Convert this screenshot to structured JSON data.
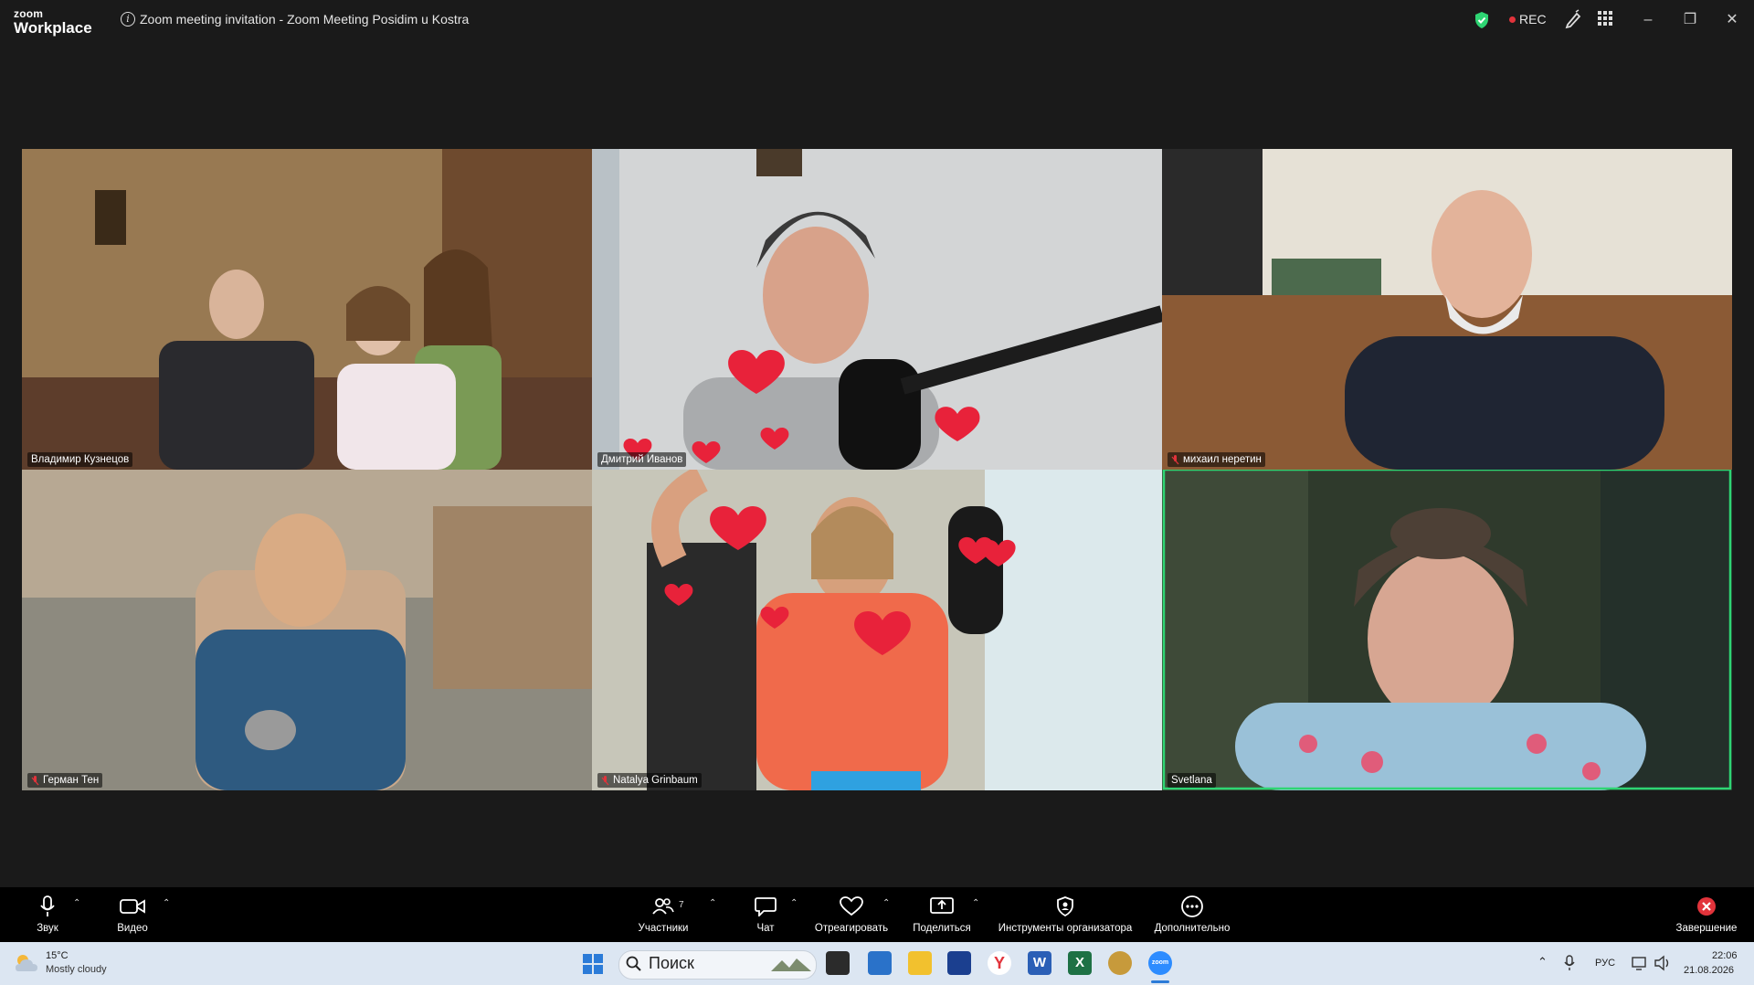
{
  "app": {
    "logo_small": "zoom",
    "logo_big": "Workplace",
    "window_title": "Zoom meeting invitation - Zoom Meeting Posidim u Kostra",
    "rec_label": "REC",
    "brand_color": "#2d8cff",
    "active_speaker_color": "#2ed573",
    "rec_color": "#e2333b"
  },
  "participants": [
    {
      "name": "Владимир Кузнецов",
      "muted": false,
      "active": false
    },
    {
      "name": "Дмитрий Иванов",
      "muted": false,
      "active": false
    },
    {
      "name": "михаил неретин",
      "muted": true,
      "active": false
    },
    {
      "name": "Герман Тен",
      "muted": true,
      "active": false
    },
    {
      "name": "Natalya Grinbaum",
      "muted": true,
      "active": false
    },
    {
      "name": "Svetlana",
      "muted": false,
      "active": true
    }
  ],
  "toolbar": {
    "audio_label": "Звук",
    "video_label": "Видео",
    "participants_label": "Участники",
    "participants_count": "7",
    "chat_label": "Чат",
    "react_label": "Отреагировать",
    "share_label": "Поделиться",
    "host_tools_label": "Инструменты организатора",
    "more_label": "Дополнительно",
    "end_label": "Завершение"
  },
  "taskbar": {
    "weather_temp": "15°C",
    "weather_desc": "Mostly cloudy",
    "search_placeholder": "Поиск",
    "lang": "РУС",
    "time": "22:06",
    "date": "21.08.2026"
  },
  "icons": {
    "shield": "shield-check-icon",
    "edit": "pen-icon",
    "apps": "grid-icon",
    "minimize": "minimize-icon",
    "restore": "restore-icon",
    "close": "close-icon"
  }
}
